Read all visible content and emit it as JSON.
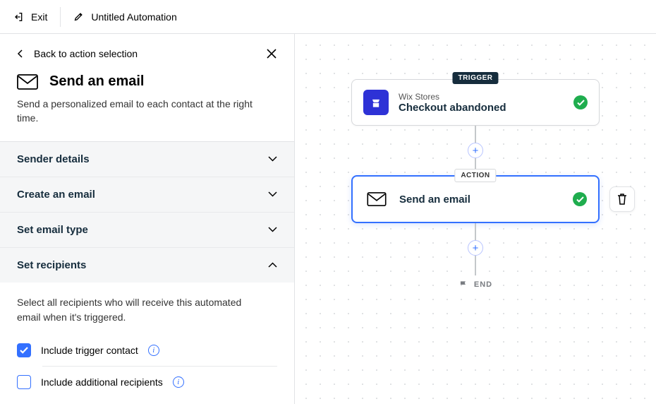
{
  "topbar": {
    "exit": "Exit",
    "title": "Untitled Automation"
  },
  "sidebar": {
    "back": "Back to action selection",
    "title": "Send an email",
    "desc": "Send a personalized email to each contact at the right time.",
    "sections": {
      "sender": "Sender details",
      "create": "Create an email",
      "type": "Set email type",
      "recipients": "Set recipients"
    },
    "recipients_desc": "Select all recipients who will receive this automated email when it's triggered.",
    "include_trigger": "Include trigger contact",
    "include_additional": "Include additional recipients"
  },
  "canvas": {
    "trigger_tag": "TRIGGER",
    "action_tag": "ACTION",
    "trigger_source": "Wix Stores",
    "trigger_label": "Checkout abandoned",
    "action_label": "Send an email",
    "end": "END"
  }
}
